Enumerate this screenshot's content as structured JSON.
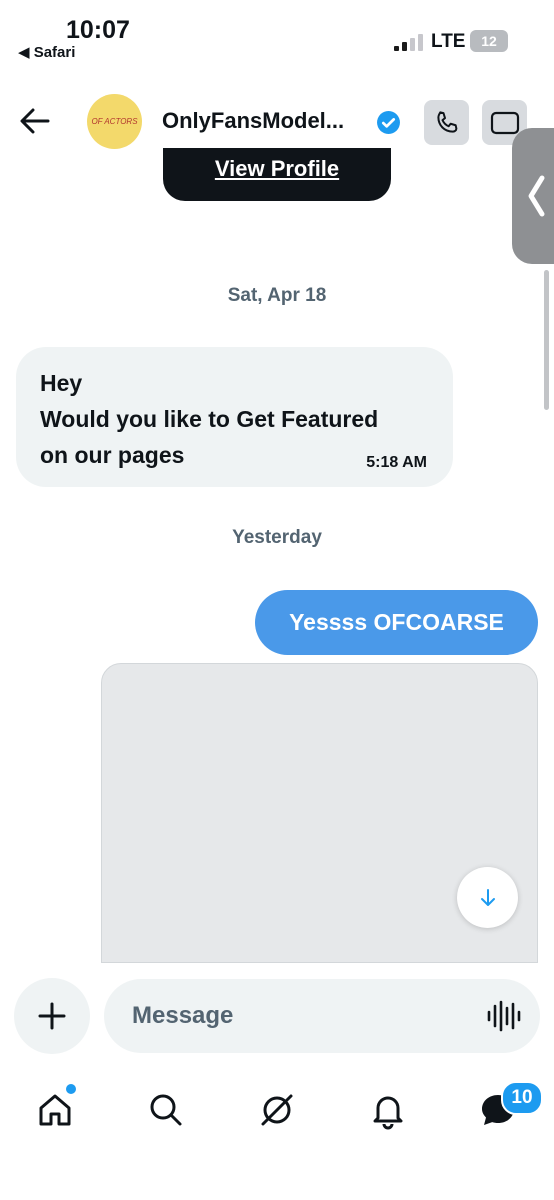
{
  "status_bar": {
    "time": "10:07",
    "back_app": "◀ Safari",
    "network": "LTE",
    "battery": "12"
  },
  "header": {
    "avatar_text": "OF ACTORS",
    "name": "OnlyFansModel...",
    "icons": [
      "back-arrow-icon",
      "verified-badge-icon",
      "phone-icon",
      "video-icon"
    ]
  },
  "colors": {
    "accent": "#1d9bf0",
    "outgoing_bubble": "#4a99e9",
    "incoming_bubble": "#eff3f4",
    "muted_text": "#536471"
  },
  "profile_card": {
    "button_label": "View Profile"
  },
  "messages": [
    {
      "date_separator": "Sat, Apr 18",
      "direction": "incoming",
      "lines": [
        "Hey",
        "Would you like to Get Featured",
        "on our pages"
      ],
      "timestamp": "5:18 AM"
    },
    {
      "date_separator": "Yesterday",
      "direction": "outgoing",
      "text": "Yessss OFCOARSE"
    },
    {
      "direction": "outgoing",
      "type": "image"
    }
  ],
  "composer": {
    "placeholder": "Message"
  },
  "tab_bar": {
    "items": [
      "home-icon",
      "search-icon",
      "grok-icon",
      "notifications-icon",
      "messages-icon"
    ],
    "messages_badge": "10"
  }
}
